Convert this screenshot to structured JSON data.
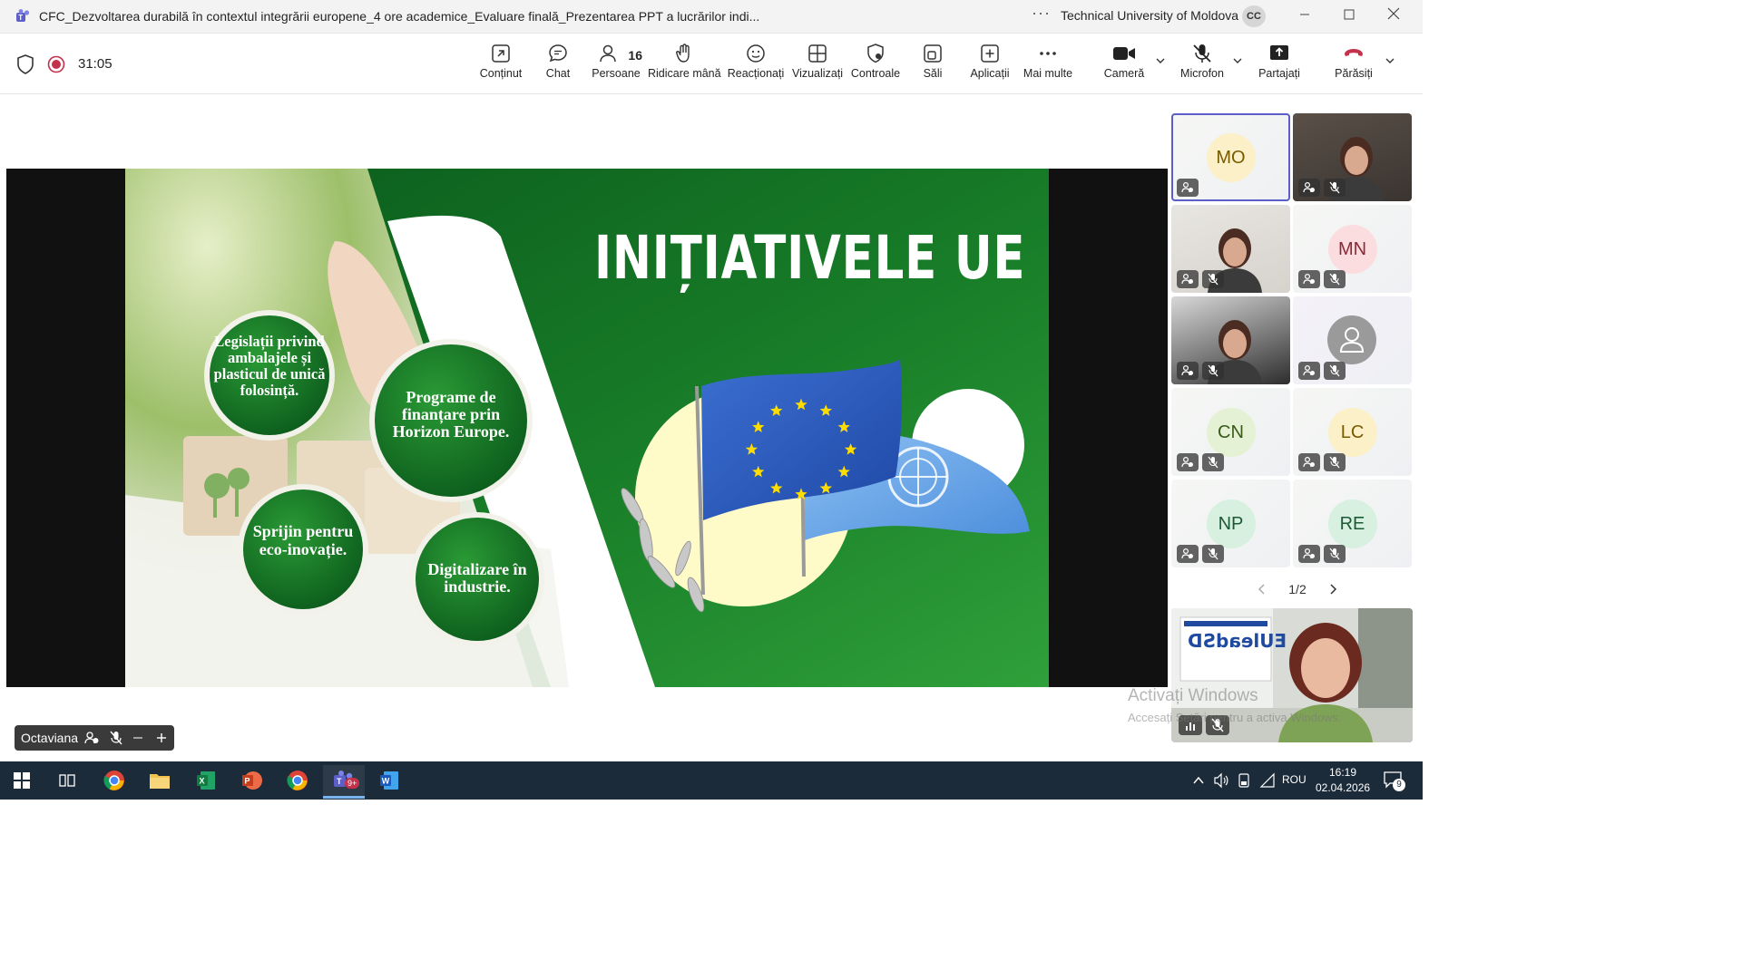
{
  "titlebar": {
    "title": "CFC_Dezvoltarea durabilă în contextul integrării europene_4 ore academice_Evaluare finală_Prezentarea PPT a lucrărilor indi...",
    "more": "···",
    "org": "Technical University of Moldova",
    "avatar": "CC"
  },
  "toolbar": {
    "timer": "31:05",
    "items": [
      {
        "label": "Conținut",
        "icon": "share-content-icon"
      },
      {
        "label": "Chat",
        "icon": "chat-icon"
      },
      {
        "label": "Persoane",
        "icon": "people-icon",
        "count": "16"
      },
      {
        "label": "Ridicare mână",
        "icon": "raise-hand-icon"
      },
      {
        "label": "Reacționați",
        "icon": "reaction-icon"
      },
      {
        "label": "Vizualizați",
        "icon": "view-icon"
      },
      {
        "label": "Controale",
        "icon": "controls-icon"
      },
      {
        "label": "Săli",
        "icon": "rooms-icon"
      },
      {
        "label": "Aplicații",
        "icon": "apps-icon"
      },
      {
        "label": "Mai multe",
        "icon": "more-icon"
      },
      {
        "label": "Cameră",
        "icon": "camera-icon"
      },
      {
        "label": "Microfon",
        "icon": "mic-off-icon"
      },
      {
        "label": "Partajați",
        "icon": "share-icon"
      },
      {
        "label": "Părăsiți",
        "icon": "leave-icon"
      }
    ]
  },
  "slide": {
    "title": "INIȚIATIVELE UE",
    "circles": [
      "Legislații privind ambalajele și plasticul de unică folosință.",
      "Programe de finanțare prin Horizon Europe.",
      "Sprijin pentru eco-inovație.",
      "Digitalizare în industrie."
    ],
    "colors": {
      "green_dark": "#0f5e1f",
      "green": "#1f8a2e",
      "eu_blue": "#2a56b8",
      "eu_star": "#ffdd00",
      "un_blue": "#5b9be0"
    }
  },
  "participants": {
    "tiles": [
      {
        "initials": "MO",
        "bg": "#fbf0c8",
        "fg": "#7a5a00",
        "type": "initials"
      },
      {
        "initials": "",
        "type": "video"
      },
      {
        "initials": "",
        "type": "video"
      },
      {
        "initials": "MN",
        "bg": "#fbdde0",
        "fg": "#8a2a36",
        "type": "initials"
      },
      {
        "initials": "",
        "type": "video"
      },
      {
        "initials": "",
        "type": "placeholder"
      },
      {
        "initials": "CN",
        "bg": "#e4f1d4",
        "fg": "#3a5a1a",
        "type": "initials"
      },
      {
        "initials": "LC",
        "bg": "#fbf0c8",
        "fg": "#7a5a00",
        "type": "initials"
      },
      {
        "initials": "NP",
        "bg": "#d7f0e0",
        "fg": "#1d5a36",
        "type": "initials"
      },
      {
        "initials": "RE",
        "bg": "#d7f0e0",
        "fg": "#1d5a36",
        "type": "initials"
      }
    ],
    "pager": "1/2"
  },
  "self_view": {
    "name": "Octaviana",
    "banner_text": "EUleadSD",
    "watermark_line1": "Activați Windows",
    "watermark_line2": "Accesați Setări pentru a activa Windows."
  },
  "taskbar": {
    "lang": "ROU",
    "time": "16:19",
    "date": "02.04.2026",
    "notifications": "9",
    "teams_badge": "9+"
  }
}
